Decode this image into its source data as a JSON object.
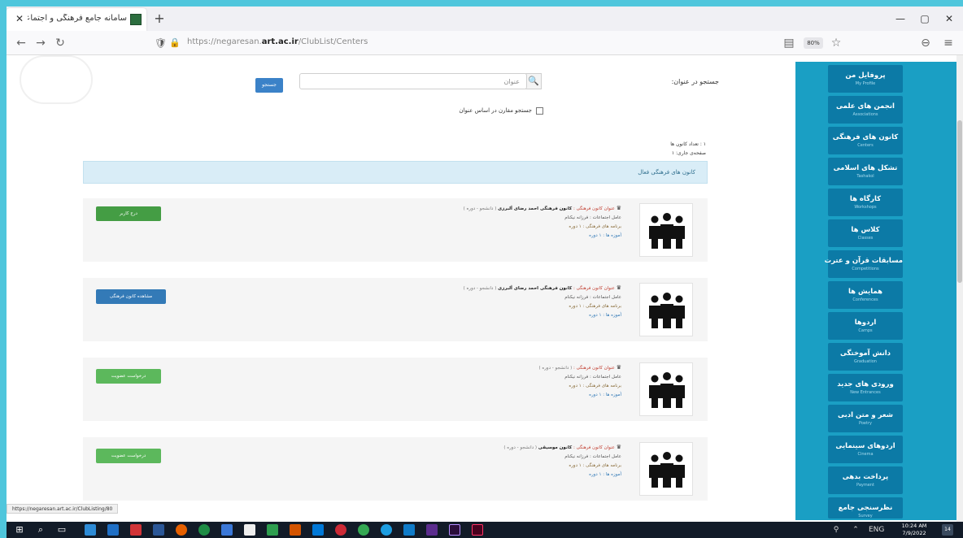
{
  "browser": {
    "tab_title": "سامانه جامع فرهنگی و اجتماعی",
    "tab_close": "✕",
    "new_tab": "+",
    "url_prefix": "https://negaresan.",
    "url_host": "art.ac.ir",
    "url_path": "/ClubList/Centers",
    "zoom": "80%",
    "status_url": "https://negaresan.art.ac.ir/ClubListing/80"
  },
  "icons": {
    "back": "←",
    "forward": "→",
    "reload": "↻",
    "shield": "🛡",
    "lock": "🔒",
    "reader": "▤",
    "star": "☆",
    "pocket": "⊖",
    "menu": "≡",
    "minimize": "—",
    "maximize": "▢",
    "close": "✕",
    "search": "🔍",
    "crown": "♛"
  },
  "search": {
    "label": "جستجو در عنوان:",
    "placeholder": "عنوان",
    "submit_label": "جستجو",
    "checkbox_label": "جستجو مقارن در اساس عنوان"
  },
  "results": {
    "total": "۱ : تعداد کانون ها",
    "page": "صفحه‌ی جاری: ۱"
  },
  "banner_title": "کانون های فرهنگی فعال",
  "cards": [
    {
      "prefix": "عنوان کانون فرهنگی :",
      "name": "کانون فرهنگی احمد رضای آلبرزی",
      "suffix": "( دانشجو - دوره )",
      "supervisor": "عامل اجتماعات : فرزانه نیکنام",
      "activities": "برنامه های فرهنگی : ۱ دوره",
      "link": "آموزه ها : ۱ دوره",
      "button": "درج کاربر"
    },
    {
      "prefix": "عنوان کانون فرهنگی :",
      "name": "کانون فرهنگی احمد رضای آلبرزی",
      "suffix": "( دانشجو - دوره )",
      "supervisor": "عامل اجتماعات : فرزانه نیکنام",
      "activities": "برنامه های فرهنگی : ۱ دوره",
      "link": "آموزه ها : ۱ دوره",
      "button": "مشاهده کانون فرهنگی"
    },
    {
      "prefix": "عنوان کانون فرهنگی :",
      "name": "",
      "suffix": "( دانشجو - دوره )",
      "supervisor": "عامل اجتماعات : فرزانه نیکنام",
      "activities": "برنامه های فرهنگی : ۱ دوره",
      "link": "آموزه ها : ۱ دوره",
      "button": "درخواست عضویت"
    },
    {
      "prefix": "عنوان کانون فرهنگی :",
      "name": "کانون موسیقی",
      "suffix": "( دانشجو - دوره )",
      "supervisor": "عامل اجتماعات : فرزانه نیکنام",
      "activities": "برنامه های فرهنگی : ۱ دوره",
      "link": "آموزه ها : ۱ دوره",
      "button": "درخواست عضویت"
    }
  ],
  "sidebar": {
    "items": [
      {
        "fa": "پروفایل من",
        "en": "My Profile"
      },
      {
        "fa": "انجمن های علمی",
        "en": "Associations"
      },
      {
        "fa": "کانون های فرهنگی",
        "en": "Centers"
      },
      {
        "fa": "تشکل های اسلامی",
        "en": "Tashakol"
      },
      {
        "fa": "کارگاه ها",
        "en": "Workshops"
      },
      {
        "fa": "کلاس ها",
        "en": "Classes"
      },
      {
        "fa": "مسابقات قرآن و عترت",
        "en": "Competitions"
      },
      {
        "fa": "همایش ها",
        "en": "Conferences"
      },
      {
        "fa": "اردوها",
        "en": "Camps"
      },
      {
        "fa": "دانش آموختگی",
        "en": "Graduation"
      },
      {
        "fa": "ورودی های جدید",
        "en": "New Entrances"
      },
      {
        "fa": "شعر و متن ادبی",
        "en": "Poetry"
      },
      {
        "fa": "اردوهای سینمایی",
        "en": "Cinema"
      },
      {
        "fa": "پرداخت بدهی",
        "en": "Payment"
      },
      {
        "fa": "نظرسنجی جامع",
        "en": "Survey"
      }
    ]
  },
  "taskbar": {
    "time": "10:24 AM",
    "date": "7/9/2022",
    "notifications": "14"
  },
  "colors": {
    "sidebar_bg": "#1a9fc4",
    "sidebar_item": "#0c7aa6",
    "accent_blue": "#337ab7",
    "success_green": "#5cb85c"
  }
}
